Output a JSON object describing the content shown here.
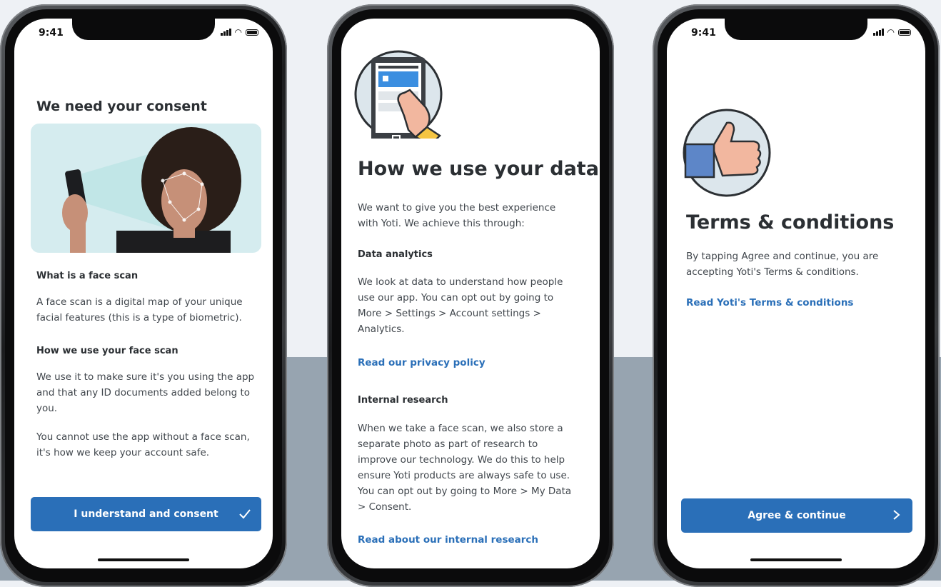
{
  "phones": [
    {
      "time": "9:41",
      "title": "We need your consent",
      "section1_title": "What is a face scan",
      "section1_body": "A face scan is a digital map of your unique facial features (this is a type of biometric).",
      "section2_title": "How we use your face scan",
      "section2_body": "We use it to make sure it's you using the app and that any ID documents added belong to you.",
      "section3_body": "You cannot use the app without a face scan, it's how we keep your account safe.",
      "button_label": "I understand and consent",
      "button_icon": "checkmark-icon"
    },
    {
      "title": "How we use your data",
      "intro": "We want to give you the best experience with Yoti. We achieve this through:",
      "section1_title": "Data analytics",
      "section1_body": "We look at data to understand how people use our app. You can opt out by going to More > Settings > Account settings > Analytics.",
      "link1": "Read our privacy policy",
      "section2_title": "Internal research",
      "section2_body": "When we take a face scan, we also store a separate photo as part of research to improve our technology. We do this to help ensure Yoti products are always safe to use. You can opt out by going to More > My Data > Consent.",
      "link2": "Read about our internal research"
    },
    {
      "time": "9:41",
      "title": "Terms & conditions",
      "body": "By tapping Agree and continue, you are accepting Yoti's Terms & conditions.",
      "link": "Read Yoti's Terms & conditions",
      "button_label": "Agree & continue",
      "button_icon": "chevron-right-icon"
    }
  ],
  "colors": {
    "accent": "#2a6fb8",
    "band": "#97a4b0",
    "background": "#eef1f5",
    "skin": "#f2b79f",
    "sleeve": "#5d86c8"
  }
}
